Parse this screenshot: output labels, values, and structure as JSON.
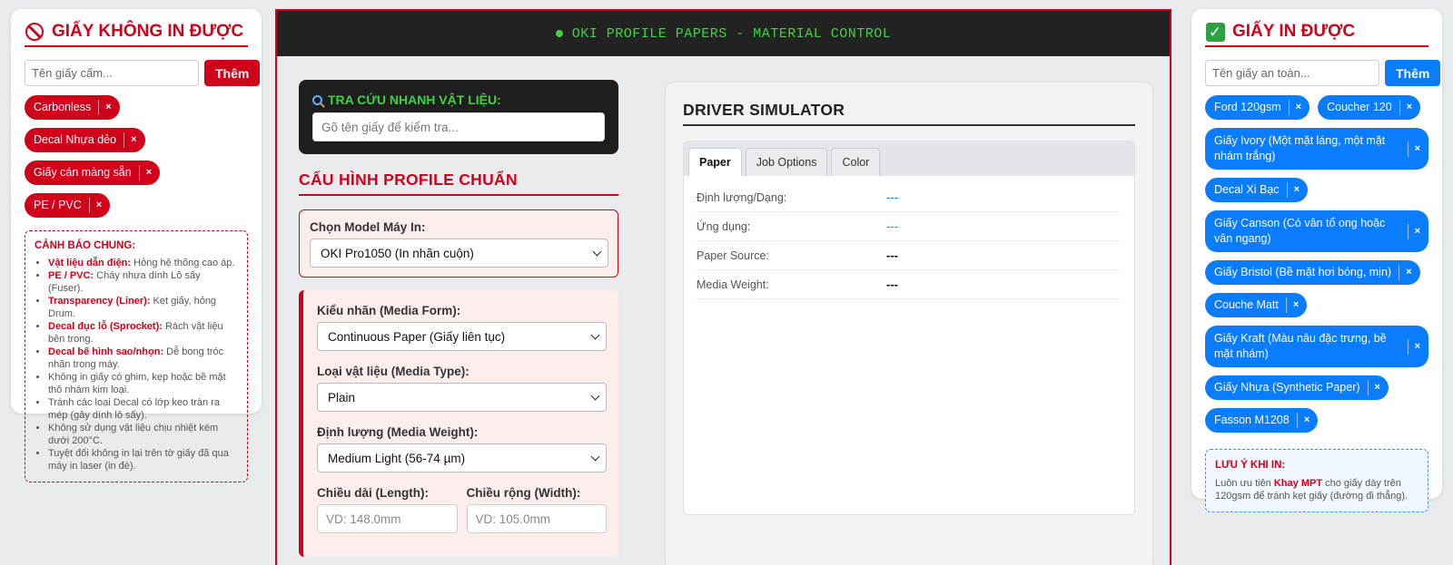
{
  "left_panel": {
    "title": "GIẤY KHÔNG IN ĐƯỢC",
    "input_placeholder": "Tên giấy cấm...",
    "add_label": "Thêm",
    "chips": [
      "Carbonless",
      "Decal Nhựa dẻo",
      "Giấy cán màng sẵn",
      "PE / PVC"
    ],
    "chip_remove": "×",
    "warning": {
      "title": "CẢNH BÁO CHUNG:",
      "items": [
        {
          "bold": "Vật liệu dẫn điện:",
          "text": " Hỏng hệ thống cao áp."
        },
        {
          "bold": "PE / PVC:",
          "text": " Cháy nhựa dính Lô sấy (Fuser)."
        },
        {
          "bold": "Transparency (Liner):",
          "text": " Kẹt giấy, hỏng Drum."
        },
        {
          "bold": "Decal đục lỗ (Sprocket):",
          "text": " Rách vật liệu bên trong."
        },
        {
          "bold": "Decal bế hình sao/nhọn:",
          "text": " Dễ bong tróc nhãn trong máy."
        },
        {
          "bold": "",
          "text": "Không in giấy có ghim, kẹp hoặc bề mặt thô nhám kim loại."
        },
        {
          "bold": "",
          "text": "Tránh các loại Decal có lớp keo tràn ra mép (gây dính lô sấy)."
        },
        {
          "bold": "",
          "text": "Không sử dụng vật liệu chịu nhiệt kém dưới 200°C."
        },
        {
          "bold": "",
          "text": "Tuyệt đối không in lại trên tờ giấy đã qua máy in laser (in đè)."
        }
      ]
    }
  },
  "header": {
    "title": "OKI PROFILE PAPERS - MATERIAL CONTROL"
  },
  "quick_search": {
    "label": "TRA CỨU NHANH VẬT LIỆU:",
    "placeholder": "Gõ tên giấy để kiểm tra..."
  },
  "profile": {
    "title": "CẤU HÌNH PROFILE CHUẨN",
    "model_label": "Chọn Model Máy In:",
    "model_value": "OKI Pro1050 (In nhãn cuộn)",
    "media_form_label": "Kiểu nhãn (Media Form):",
    "media_form_value": "Continuous Paper (Giấy liên tục)",
    "media_type_label": "Loại vật liệu (Media Type):",
    "media_type_value": "Plain",
    "media_weight_label": "Định lượng (Media Weight):",
    "media_weight_value": "Medium Light (56-74 µm)",
    "length_label": "Chiều dài (Length):",
    "length_placeholder": "VD: 148.0mm",
    "width_label": "Chiều rộng (Width):",
    "width_placeholder": "VD: 105.0mm"
  },
  "driver": {
    "title": "DRIVER SIMULATOR",
    "tabs": [
      "Paper",
      "Job Options",
      "Color"
    ],
    "active_tab": "Paper",
    "rows": [
      {
        "key": "Định lượng/Dạng:",
        "value": "---"
      },
      {
        "key": "Ứng dụng:",
        "value": "---"
      },
      {
        "key": "Paper Source:",
        "value": "---"
      },
      {
        "key": "Media Weight:",
        "value": "---"
      }
    ]
  },
  "right_panel": {
    "title": "GIẤY IN ĐƯỢC",
    "input_placeholder": "Tên giấy an toàn...",
    "add_label": "Thêm",
    "chips": [
      "Ford 120gsm",
      "Coucher 120",
      "Giấy Ivory (Một mặt láng, một mặt nhám trắng)",
      "Decal Xi Bạc",
      "Giấy Canson (Có vân tổ ong hoặc vân ngang)",
      "Giấy Bristol (Bề mặt hơi bóng, mịn)",
      "Couche Matt",
      "Giấy Kraft (Màu nâu đặc trưng, bề mặt nhám)",
      "Giấy Nhựa (Synthetic Paper)",
      "Fasson M1208"
    ],
    "chip_remove": "×",
    "note": {
      "title": "LƯU Ý KHI IN:",
      "pre": "Luôn ưu tiên ",
      "bold": "Khay MPT",
      "post": " cho giấy dày trên 120gsm để tránh kẹt giấy (đường đi thẳng)."
    }
  },
  "colors": {
    "danger": "#d0021b",
    "safe": "#0a7cff",
    "terminal_green": "#3fd43f"
  }
}
